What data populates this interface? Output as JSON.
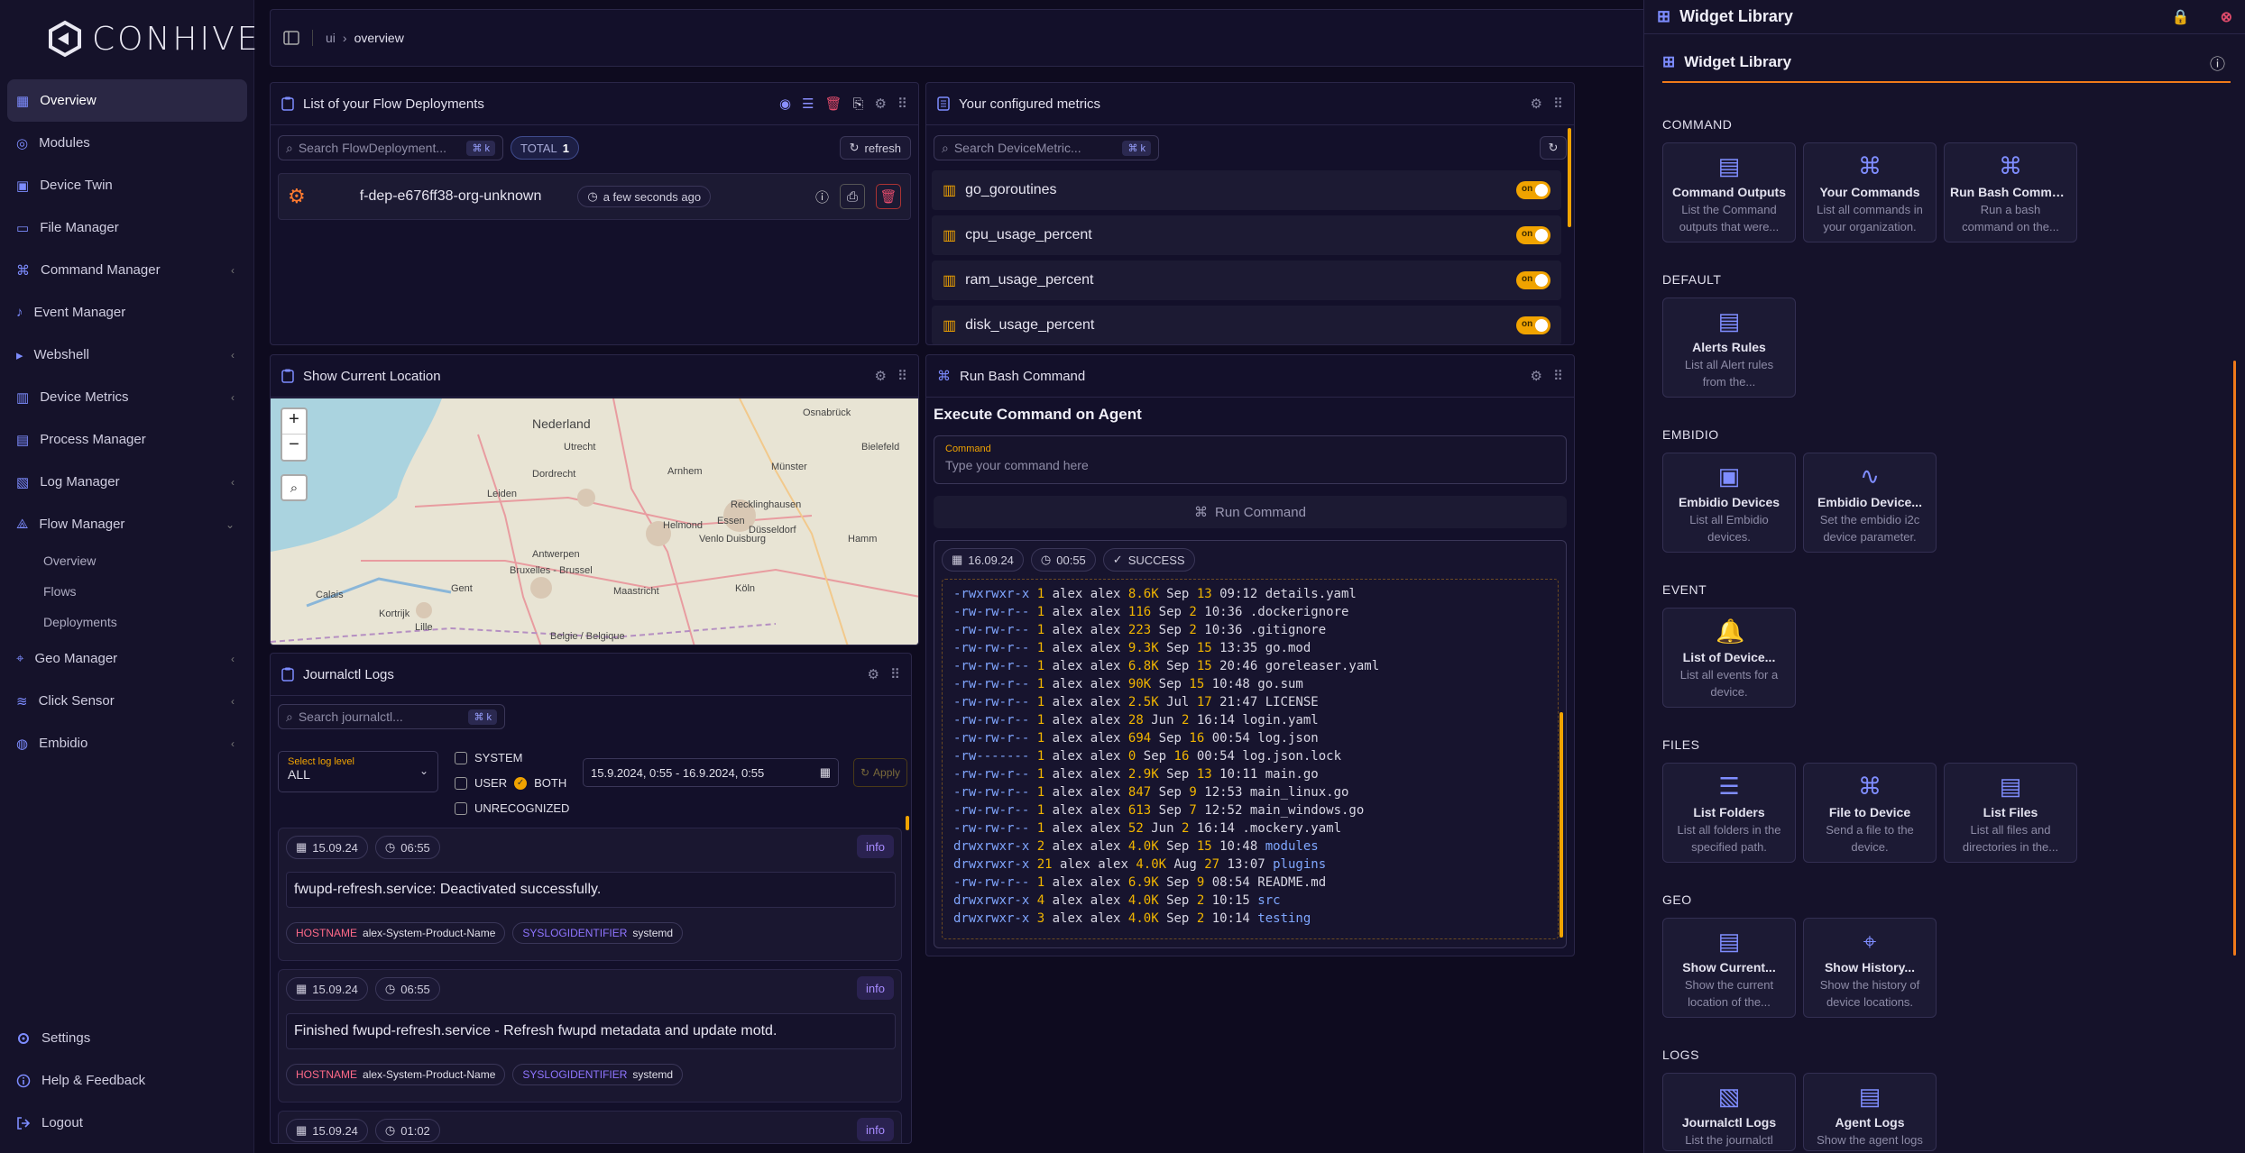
{
  "app": {
    "brand": "CONHIVE"
  },
  "sidebar": {
    "items": [
      {
        "label": "Overview",
        "icon": "grid-icon"
      },
      {
        "label": "Modules",
        "icon": "globe-icon"
      },
      {
        "label": "Device Twin",
        "icon": "device-icon"
      },
      {
        "label": "File Manager",
        "icon": "folder-icon"
      },
      {
        "label": "Command Manager",
        "icon": "command-icon"
      },
      {
        "label": "Event Manager",
        "icon": "bell-icon"
      },
      {
        "label": "Webshell",
        "icon": "terminal-icon"
      },
      {
        "label": "Device Metrics",
        "icon": "bar-chart-icon"
      },
      {
        "label": "Process Manager",
        "icon": "process-icon"
      },
      {
        "label": "Log Manager",
        "icon": "log-icon"
      },
      {
        "label": "Flow Manager",
        "icon": "flow-icon"
      }
    ],
    "flow_sub": [
      "Overview",
      "Flows",
      "Deployments"
    ],
    "items2": [
      {
        "label": "Geo Manager",
        "icon": "map-icon"
      },
      {
        "label": "Click Sensor",
        "icon": "sensor-icon"
      },
      {
        "label": "Embidio",
        "icon": "chip-icon"
      }
    ],
    "bottom": [
      "Settings",
      "Help & Feedback",
      "Logout"
    ]
  },
  "breadcrumb": {
    "root": "ui",
    "sep": "›",
    "current": "overview"
  },
  "flows": {
    "title": "List of your Flow Deployments",
    "search_placeholder": "Search FlowDeployment...",
    "kbd": "⌘ k",
    "total_label": "TOTAL",
    "total": "1",
    "refresh": "refresh",
    "row": {
      "name": "f-dep-e676ff38-org-unknown",
      "time": "a few seconds ago"
    }
  },
  "metrics": {
    "title": "Your configured metrics",
    "search_placeholder": "Search DeviceMetric...",
    "kbd": "⌘ k",
    "toggle": "on",
    "rows": [
      "go_goroutines",
      "cpu_usage_percent",
      "ram_usage_percent",
      "disk_usage_percent"
    ]
  },
  "location": {
    "title": "Show Current Location",
    "zoom_in": "+",
    "zoom_out": "−",
    "labels": [
      "Nederland",
      "Utrecht",
      "Osnabrück",
      "Münster",
      "Bielefeld",
      "Dordrecht",
      "Arnhem",
      "Recklinghausen",
      "Essen",
      "Helmond",
      "Venlo",
      "Duisburg",
      "Düsseldorf",
      "Antwerpen",
      "Bruxelles - Brussel",
      "Köln",
      "Maastricht",
      "Lille",
      "Calais",
      "Gent",
      "Kortrijk",
      "Belgie / Belgique",
      "Leiden",
      "Hamm"
    ]
  },
  "bash": {
    "title": "Run Bash Command",
    "heading": "Execute Command on Agent",
    "command_label": "Command",
    "command_placeholder": "Type your command here",
    "run_label": "Run Command",
    "date": "16.09.24",
    "time": "00:55",
    "status": "SUCCESS",
    "lines": [
      [
        "-rwxrwxr-x",
        "1",
        "alex",
        "alex",
        "8.6K",
        "Sep",
        "13",
        "09:12",
        "details.yaml"
      ],
      [
        "-rw-rw-r--",
        "1",
        "alex",
        "alex",
        "116",
        "Sep",
        "2",
        "10:36",
        ".dockerignore"
      ],
      [
        "-rw-rw-r--",
        "1",
        "alex",
        "alex",
        "223",
        "Sep",
        "2",
        "10:36",
        ".gitignore"
      ],
      [
        "-rw-rw-r--",
        "1",
        "alex",
        "alex",
        "9.3K",
        "Sep",
        "15",
        "13:35",
        "go.mod"
      ],
      [
        "-rw-rw-r--",
        "1",
        "alex",
        "alex",
        "6.8K",
        "Sep",
        "15",
        "20:46",
        "goreleaser.yaml"
      ],
      [
        "-rw-rw-r--",
        "1",
        "alex",
        "alex",
        "90K",
        "Sep",
        "15",
        "10:48",
        "go.sum"
      ],
      [
        "-rw-rw-r--",
        "1",
        "alex",
        "alex",
        "2.5K",
        "Jul",
        "17",
        "21:47",
        "LICENSE"
      ],
      [
        "-rw-rw-r--",
        "1",
        "alex",
        "alex",
        "28",
        "Jun",
        "2",
        "16:14",
        "login.yaml"
      ],
      [
        "-rw-rw-r--",
        "1",
        "alex",
        "alex",
        "694",
        "Sep",
        "16",
        "00:54",
        "log.json"
      ],
      [
        "-rw-------",
        "1",
        "alex",
        "alex",
        "0",
        "Sep",
        "16",
        "00:54",
        "log.json.lock"
      ],
      [
        "-rw-rw-r--",
        "1",
        "alex",
        "alex",
        "2.9K",
        "Sep",
        "13",
        "10:11",
        "main.go"
      ],
      [
        "-rw-rw-r--",
        "1",
        "alex",
        "alex",
        "847",
        "Sep",
        "9",
        "12:53",
        "main_linux.go"
      ],
      [
        "-rw-rw-r--",
        "1",
        "alex",
        "alex",
        "613",
        "Sep",
        "7",
        "12:52",
        "main_windows.go"
      ],
      [
        "-rw-rw-r--",
        "1",
        "alex",
        "alex",
        "52",
        "Jun",
        "2",
        "16:14",
        ".mockery.yaml"
      ],
      [
        "drwxrwxr-x",
        "2",
        "alex",
        "alex",
        "4.0K",
        "Sep",
        "15",
        "10:48",
        "modules"
      ],
      [
        "drwxrwxr-x",
        "21",
        "alex",
        "alex",
        "4.0K",
        "Aug",
        "27",
        "13:07",
        "plugins"
      ],
      [
        "-rw-rw-r--",
        "1",
        "alex",
        "alex",
        "6.9K",
        "Sep",
        "9",
        "08:54",
        "README.md"
      ],
      [
        "drwxrwxr-x",
        "4",
        "alex",
        "alex",
        "4.0K",
        "Sep",
        "2",
        "10:15",
        "src"
      ],
      [
        "drwxrwxr-x",
        "3",
        "alex",
        "alex",
        "4.0K",
        "Sep",
        "2",
        "10:14",
        "testing"
      ]
    ]
  },
  "journal": {
    "title": "Journalctl Logs",
    "search_placeholder": "Search journalctl...",
    "kbd": "⌘ k",
    "level_label": "Select log level",
    "level_value": "ALL",
    "opt_system": "SYSTEM",
    "opt_user": "USER",
    "opt_both": "BOTH",
    "opt_unrecognized": "UNRECOGNIZED",
    "range": "15.9.2024, 0:55 - 16.9.2024, 0:55",
    "apply": "Apply",
    "entries": [
      {
        "date": "15.09.24",
        "time": "06:55",
        "level": "info",
        "msg": "fwupd-refresh.service: Deactivated successfully.",
        "hk": "HOSTNAME",
        "hv": "alex-System-Product-Name",
        "sk": "SYSLOGIDENTIFIER",
        "sv": "systemd"
      },
      {
        "date": "15.09.24",
        "time": "06:55",
        "level": "info",
        "msg": "Finished fwupd-refresh.service - Refresh fwupd metadata and update motd.",
        "hk": "HOSTNAME",
        "hv": "alex-System-Product-Name",
        "sk": "SYSLOGIDENTIFIER",
        "sv": "systemd"
      },
      {
        "date": "15.09.24",
        "time": "01:02",
        "level": "info"
      }
    ]
  },
  "widget_library": {
    "window_title": "Widget Library",
    "title": "Widget Library",
    "sections": [
      {
        "name": "COMMAND",
        "cards": [
          {
            "title": "Command Outputs",
            "desc": "List the Command outputs that were...",
            "icon": "clipboard-icon"
          },
          {
            "title": "Your Commands",
            "desc": "List all commands in your organization.",
            "icon": "command-icon"
          },
          {
            "title": "Run Bash Command",
            "desc": "Run a bash command on the...",
            "icon": "command-icon"
          }
        ]
      },
      {
        "name": "DEFAULT",
        "cards": [
          {
            "title": "Alerts Rules",
            "desc": "List all Alert rules from the...",
            "icon": "clipboard-icon"
          }
        ]
      },
      {
        "name": "EMBIDIO",
        "cards": [
          {
            "title": "Embidio Devices",
            "desc": "List all Embidio devices.",
            "icon": "device-icon"
          },
          {
            "title": "Embidio Device...",
            "desc": "Set the embidio i2c device parameter.",
            "icon": "pulse-icon"
          }
        ]
      },
      {
        "name": "EVENT",
        "cards": [
          {
            "title": "List of Device...",
            "desc": "List all events for a device.",
            "icon": "bell-icon"
          }
        ]
      },
      {
        "name": "FILES",
        "cards": [
          {
            "title": "List Folders",
            "desc": "List all folders in the specified path.",
            "icon": "database-icon"
          },
          {
            "title": "File to Device",
            "desc": "Send a file to the device.",
            "icon": "command-icon"
          },
          {
            "title": "List Files",
            "desc": "List all files and directories in the...",
            "icon": "clipboard-icon"
          }
        ]
      },
      {
        "name": "GEO",
        "cards": [
          {
            "title": "Show Current...",
            "desc": "Show the current location of the...",
            "icon": "clipboard-icon"
          },
          {
            "title": "Show History...",
            "desc": "Show the history of device locations.",
            "icon": "map-icon"
          }
        ]
      },
      {
        "name": "LOGS",
        "cards": [
          {
            "title": "Journalctl Logs",
            "desc": "List the journalctl",
            "icon": "log-icon"
          },
          {
            "title": "Agent Logs",
            "desc": "Show the agent logs",
            "icon": "clipboard-icon"
          }
        ]
      }
    ]
  },
  "colors": {
    "accent": "#7d8cff",
    "orange": "#f0a300",
    "background": "#0e0b1f",
    "panel": "#13102a"
  }
}
